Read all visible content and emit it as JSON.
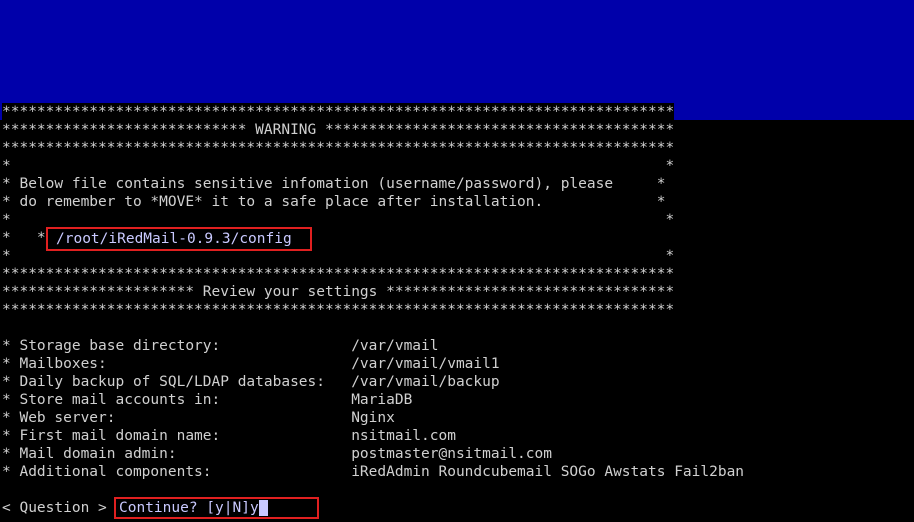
{
  "colors": {
    "backdrop": "#0000aa",
    "terminal_bg": "#000000",
    "terminal_text": "#d0d0d0",
    "highlight_border": "#e02020",
    "input_text": "#c9c9ff"
  },
  "lines": [
    "*****************************************************************************",
    "**************************** WARNING ****************************************",
    "*****************************************************************************",
    "*                                                                           *",
    "* Below file contains sensitive infomation (username/password), please     *",
    "* do remember to *MOVE* it to a safe place after installation.             *",
    "*                                                                           *",
    "*   *",
    "*                                                                           *",
    "*****************************************************************************",
    "********************** Review your settings *********************************",
    "*****************************************************************************",
    "",
    "* Storage base directory:               /var/vmail",
    "* Mailboxes:                            /var/vmail/vmail1",
    "* Daily backup of SQL/LDAP databases:   /var/vmail/backup",
    "* Store mail accounts in:               MariaDB",
    "* Web server:                           Nginx",
    "* First mail domain name:               nsitmail.com",
    "* Mail domain admin:                    postmaster@nsitmail.com",
    "* Additional components:                iRedAdmin Roundcubemail SOGo Awstats Fail2ban",
    "",
    "< Question > "
  ],
  "config_path": "/root/iRedMail-0.9.3/config",
  "prompt": {
    "question": "Continue? [y|N]",
    "answer": "y"
  }
}
